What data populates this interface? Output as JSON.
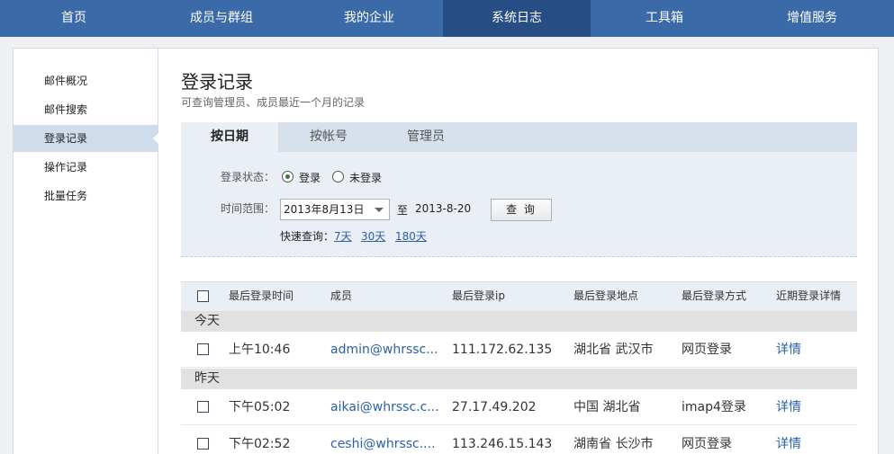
{
  "nav": {
    "items": [
      "首页",
      "成员与群组",
      "我的企业",
      "系统日志",
      "工具箱",
      "增值服务"
    ]
  },
  "sidebar": {
    "items": [
      "邮件概况",
      "邮件搜索",
      "登录记录",
      "操作记录",
      "批量任务"
    ]
  },
  "page": {
    "title": "登录记录",
    "subtitle": "可查询管理员、成员最近一个月的记录"
  },
  "filter": {
    "tabs": [
      "按日期",
      "按帐号",
      "管理员"
    ],
    "status_label": "登录状态：",
    "status_options": [
      "登录",
      "未登录"
    ],
    "range_label": "时间范围：",
    "start_date": "2013年8月13日",
    "to_label": "至",
    "end_date": "2013-8-20",
    "query_button": "查 询",
    "quick_label": "快速查询：",
    "quick_links": [
      "7天",
      "30天",
      "180天"
    ]
  },
  "table": {
    "headers": [
      "最后登录时间",
      "成员",
      "最后登录ip",
      "最后登录地点",
      "最后登录方式",
      "近期登录详情"
    ],
    "groups": [
      {
        "label": "今天",
        "rows": [
          {
            "time": "上午10:46",
            "member": "admin@whrssc...",
            "ip": "111.172.62.135",
            "location": "湖北省 武汉市",
            "method": "网页登录",
            "detail": "详情"
          }
        ]
      },
      {
        "label": "昨天",
        "rows": [
          {
            "time": "下午05:02",
            "member": "aikai@whrssc.c...",
            "ip": "27.17.49.202",
            "location": "中国 湖北省",
            "method": "imap4登录",
            "detail": "详情"
          },
          {
            "time": "下午02:52",
            "member": "ceshi@whrssc....",
            "ip": "113.246.15.143",
            "location": "湖南省 长沙市",
            "method": "网页登录",
            "detail": "详情"
          }
        ]
      }
    ]
  }
}
